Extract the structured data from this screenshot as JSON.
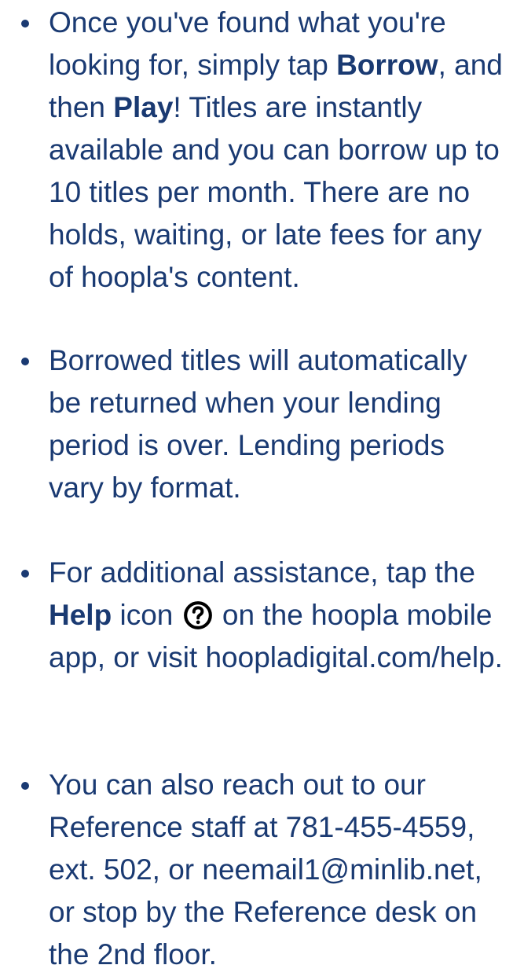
{
  "items": [
    {
      "t1": "Once you've found what you're looking for, simply tap ",
      "b1": "Borrow",
      "t2": ", and then ",
      "b2": "Play",
      "t3": "! Titles are instantly available and you can borrow up to 10 titles per month. There are no holds, waiting, or late fees for any of hoopla's content."
    },
    {
      "t1": "Borrowed titles will automatically be returned when your lending period is over. Lending periods vary by format."
    },
    {
      "t1": "For additional assistance, tap the ",
      "b1": "Help",
      "t2": " icon ",
      "icon": "question-mark-circle-icon",
      "t3": " on the hoopla mobile app, or visit hoopladigital.com/help."
    },
    {
      "t1": "You can also reach out to our Reference staff at 781-455-4559, ext. 502, or neemail1@minlib.net, or stop by the Reference desk on the 2nd floor."
    }
  ],
  "colors": {
    "text": "#1a3a72",
    "icon": "#000000"
  }
}
